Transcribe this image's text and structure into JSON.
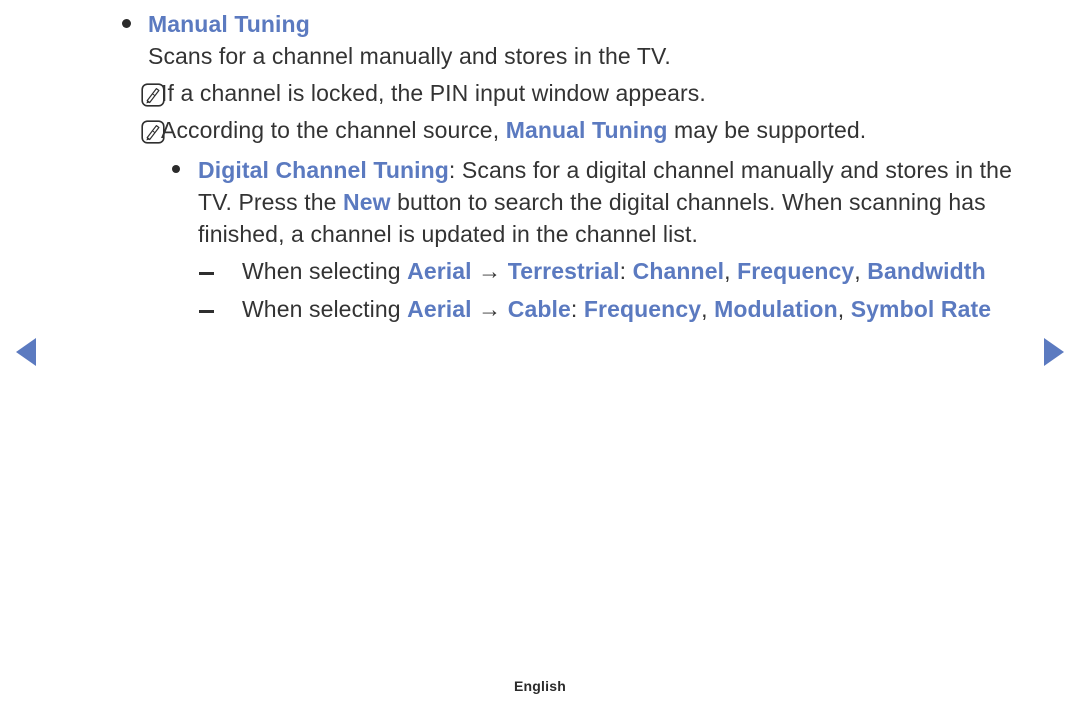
{
  "nav": {
    "prev_label": "previous page",
    "next_label": "next page"
  },
  "footer": {
    "language": "English"
  },
  "sections": [
    {
      "id": "manual-tuning",
      "marker": "bullet",
      "heading": "Manual Tuning",
      "body": "Scans for a channel manually and stores in the TV."
    }
  ],
  "notes": [
    {
      "icon": "note-pencil-icon",
      "segments": [
        {
          "text": "If a channel is locked, the PIN input window appears.",
          "style": "plain"
        }
      ]
    },
    {
      "icon": "note-pencil-icon",
      "segments": [
        {
          "text": "According to the channel source, ",
          "style": "plain"
        },
        {
          "text": "Manual Tuning",
          "style": "accent"
        },
        {
          "text": " may be supported.",
          "style": "plain"
        }
      ]
    }
  ],
  "digital_channel_tuning": {
    "marker": "bullet",
    "segments": [
      {
        "text": "Digital Channel Tuning",
        "style": "accent"
      },
      {
        "text": ": Scans for a digital channel manually and stores in the TV. Press the ",
        "style": "plain"
      },
      {
        "text": "New",
        "style": "accent"
      },
      {
        "text": " button to search the digital channels. When scanning has finished, a channel is updated in the channel list.",
        "style": "plain"
      }
    ]
  },
  "dash_items": [
    {
      "marker": "dash",
      "segments": [
        {
          "text": "When selecting ",
          "style": "plain"
        },
        {
          "text": "Aerial",
          "style": "accent"
        },
        {
          "text": " → ",
          "style": "plain"
        },
        {
          "text": "Terrestrial",
          "style": "accent"
        },
        {
          "text": ": ",
          "style": "plain"
        },
        {
          "text": "Channel",
          "style": "accent"
        },
        {
          "text": ", ",
          "style": "plain"
        },
        {
          "text": "Frequency",
          "style": "accent"
        },
        {
          "text": ", ",
          "style": "plain"
        },
        {
          "text": "Bandwidth",
          "style": "accent"
        }
      ]
    },
    {
      "marker": "dash",
      "segments": [
        {
          "text": "When selecting ",
          "style": "plain"
        },
        {
          "text": "Aerial",
          "style": "accent"
        },
        {
          "text": " → ",
          "style": "plain"
        },
        {
          "text": "Cable",
          "style": "accent"
        },
        {
          "text": ": ",
          "style": "plain"
        },
        {
          "text": "Frequency",
          "style": "accent"
        },
        {
          "text": ", ",
          "style": "plain"
        },
        {
          "text": "Modulation",
          "style": "accent"
        },
        {
          "text": ", ",
          "style": "plain"
        },
        {
          "text": "Symbol Rate",
          "style": "accent"
        }
      ]
    }
  ],
  "colors": {
    "accent": "#5b7ac0",
    "body_text": "#333333",
    "background": "#ffffff"
  }
}
